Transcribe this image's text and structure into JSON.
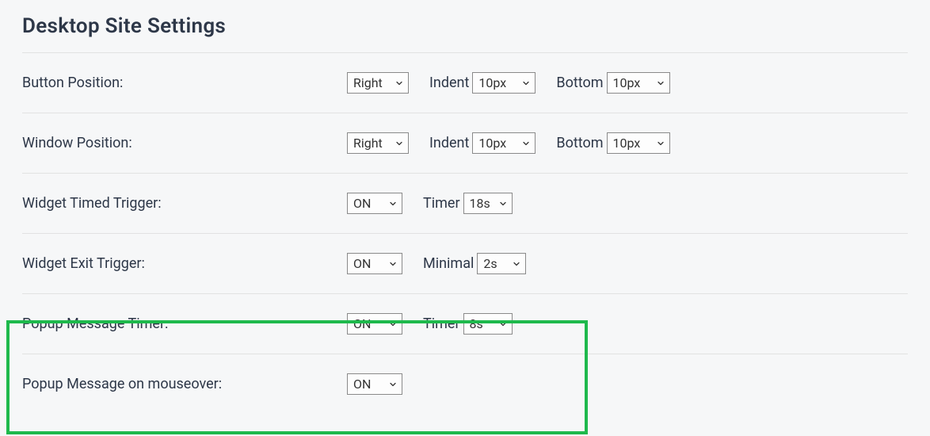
{
  "page": {
    "title": "Desktop Site Settings"
  },
  "rows": {
    "button_position": {
      "label": "Button Position:",
      "side_value": "Right",
      "indent_label": "Indent",
      "indent_value": "10px",
      "bottom_label": "Bottom",
      "bottom_value": "10px"
    },
    "window_position": {
      "label": "Window Position:",
      "side_value": "Right",
      "indent_label": "Indent",
      "indent_value": "10px",
      "bottom_label": "Bottom",
      "bottom_value": "10px"
    },
    "widget_timed_trigger": {
      "label": "Widget Timed Trigger:",
      "state_value": "ON",
      "timer_label": "Timer",
      "timer_value": "18s"
    },
    "widget_exit_trigger": {
      "label": "Widget Exit Trigger:",
      "state_value": "ON",
      "minimal_label": "Minimal",
      "minimal_value": "2s"
    },
    "popup_message_timer": {
      "label": "Popup Message Timer:",
      "state_value": "ON",
      "timer_label": "Timer",
      "timer_value": "8s"
    },
    "popup_message_mouseover": {
      "label": "Popup Message on mouseover:",
      "state_value": "ON"
    }
  }
}
